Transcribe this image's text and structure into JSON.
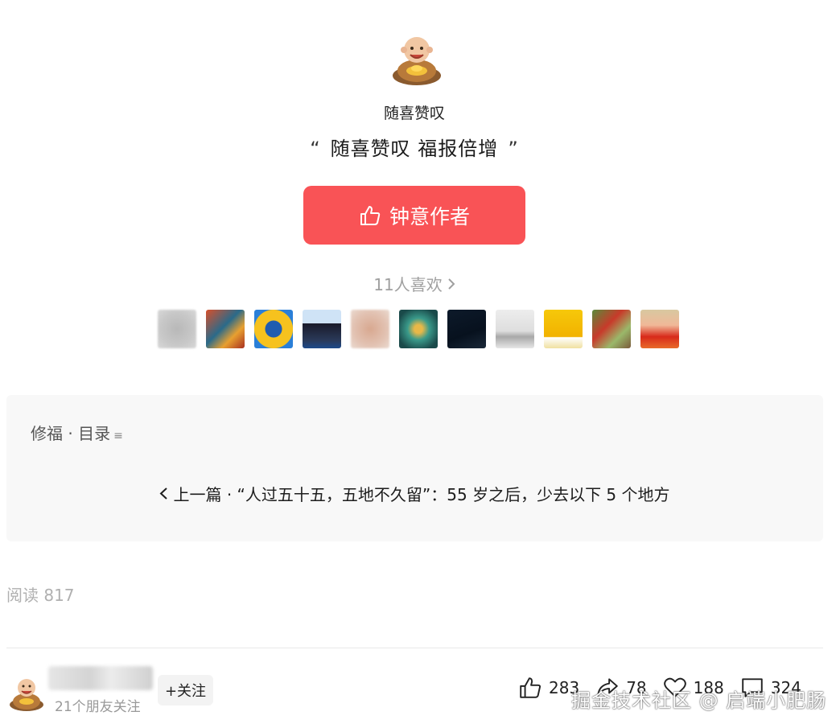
{
  "author": {
    "name": "随喜赞叹",
    "quote_open": "“",
    "quote_text": "随喜赞叹 福报倍增",
    "quote_close": "”"
  },
  "reward_button": {
    "label": "钟意作者",
    "icon": "thumb-up-icon",
    "color": "#f95356"
  },
  "likes": {
    "label": "11人喜欢",
    "chevron": "›"
  },
  "fans": [
    {
      "name": "fan-1"
    },
    {
      "name": "fan-2"
    },
    {
      "name": "fan-3"
    },
    {
      "name": "fan-4"
    },
    {
      "name": "fan-5"
    },
    {
      "name": "fan-6"
    },
    {
      "name": "fan-7"
    },
    {
      "name": "fan-8"
    },
    {
      "name": "fan-9"
    },
    {
      "name": "fan-10"
    },
    {
      "name": "fan-11"
    }
  ],
  "catalog": {
    "title": "修福 · 目录",
    "menu_icon": "≡",
    "prev_label": "上一篇 · “人过五十五，五地不久留”：55 岁之后，少去以下 5 个地方"
  },
  "read_count": "阅读 817",
  "bottom": {
    "friends": "21个朋友关注",
    "follow": "+关注",
    "stats": {
      "likes": "283",
      "shares": "78",
      "favorites": "188",
      "comments": "324"
    },
    "watermark": "掘金技术社区 @ 启端小肥肠"
  }
}
